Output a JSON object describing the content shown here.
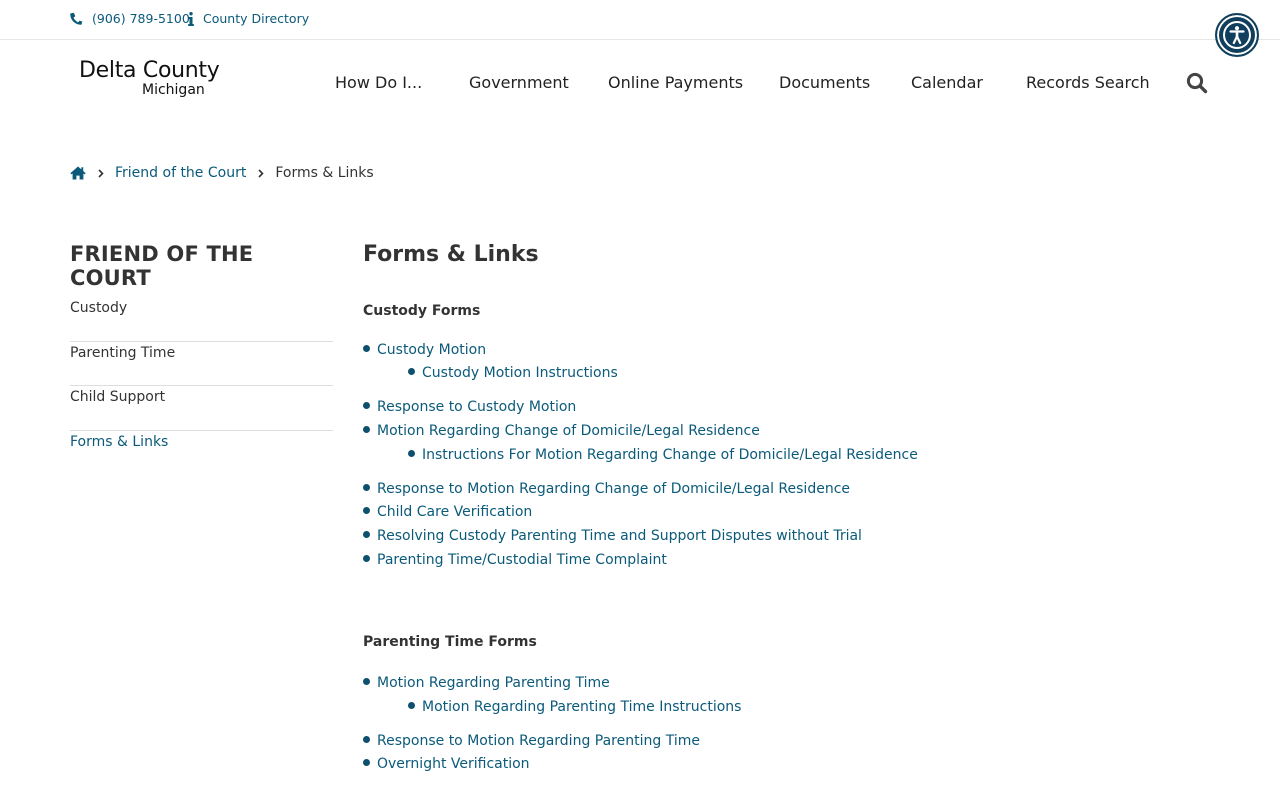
{
  "topbar": {
    "phone": "(906) 789-5100",
    "directory": "County Directory"
  },
  "logo": {
    "line1": "Delta County",
    "line2": "Michigan"
  },
  "nav": {
    "items": [
      "How Do I...",
      "Government",
      "Online Payments",
      "Documents",
      "Calendar",
      "Records Search"
    ]
  },
  "breadcrumb": {
    "parent": "Friend of the Court",
    "current": "Forms & Links"
  },
  "sidebar": {
    "title": "FRIEND OF THE COURT",
    "items": [
      "Custody",
      "Parenting Time",
      "Child Support",
      "Forms & Links"
    ],
    "active_index": 3
  },
  "content": {
    "title": "Forms & Links",
    "sections": [
      {
        "title": "Custody Forms",
        "links": [
          "Custody Motion",
          "Custody Motion Instructions",
          "Response to Custody Motion",
          "Motion Regarding Change of Domicile/Legal Residence",
          "Instructions For Motion Regarding Change of Domicile/Legal Residence",
          "Response to Motion Regarding Change of Domicile/Legal Residence",
          "Child Care Verification",
          "Resolving Custody Parenting Time and Support Disputes without Trial",
          "Parenting Time/Custodial Time Complaint"
        ]
      },
      {
        "title": "Parenting Time Forms",
        "links": [
          "Motion Regarding Parenting Time",
          "Motion Regarding Parenting Time Instructions",
          "Response to Motion Regarding Parenting Time",
          "Overnight Verification"
        ]
      }
    ]
  },
  "colors": {
    "link": "#0b5a7a",
    "accessibility_button": "#0f3f5c",
    "text": "#333333"
  },
  "icons": [
    "phone-icon",
    "info-icon",
    "accessibility-icon",
    "search-icon",
    "home-icon",
    "chevron-right-icon"
  ]
}
